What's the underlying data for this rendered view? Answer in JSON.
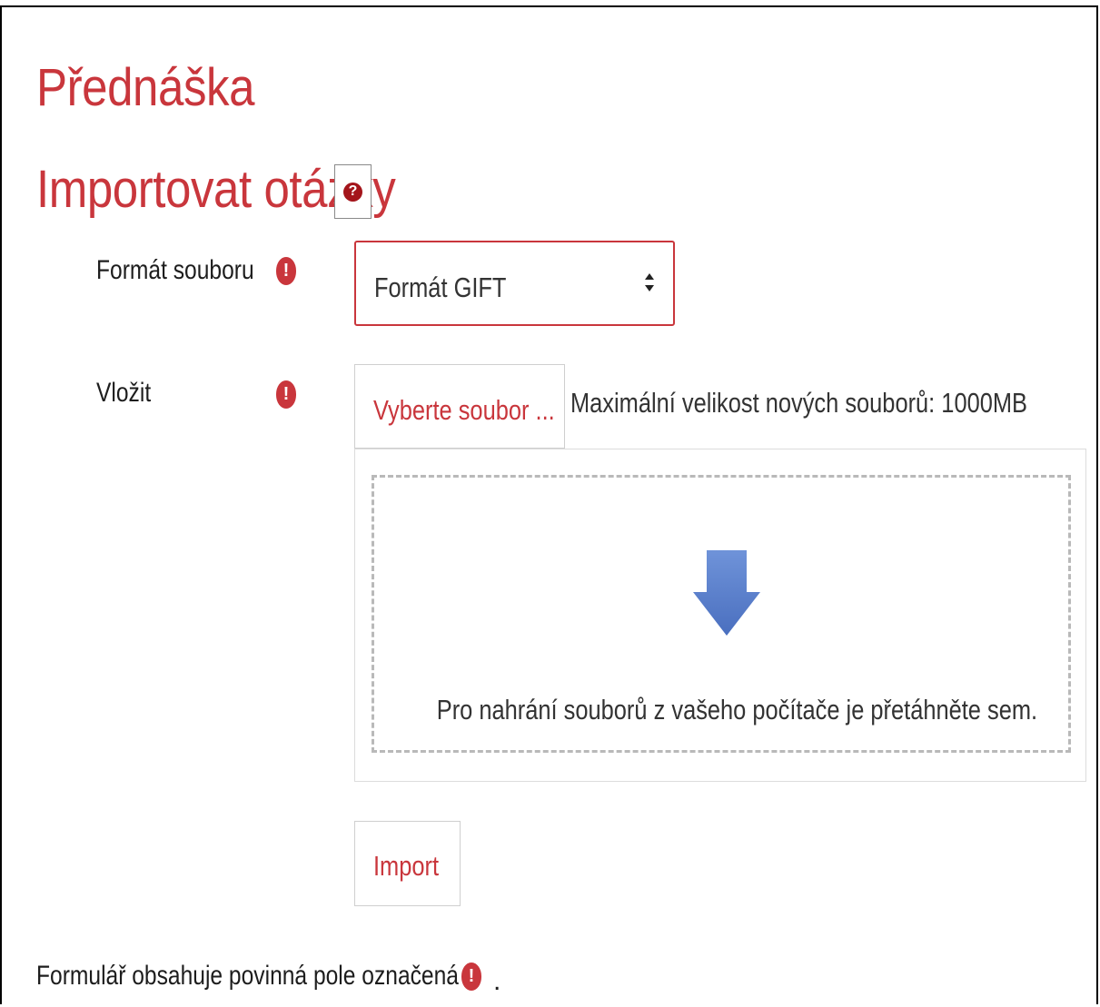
{
  "course": {
    "title": "Přednáška"
  },
  "page": {
    "title": "Importovat otázky",
    "help_icon": "question-circle-icon"
  },
  "form": {
    "format_label": "Formát souboru",
    "format_value": "Formát GIFT",
    "upload_label": "Vložit",
    "choose_file_label": "Vyberte soubor ...",
    "max_size_text": "Maximální velikost nových souborů: 1000MB",
    "dropzone_text": "Pro nahrání souborů z vašeho počítače je přetáhněte sem.",
    "import_label": "Import",
    "required_note": "Formulář obsahuje povinná pole označená",
    "required_note_end": "."
  },
  "colors": {
    "accent": "#c9363c",
    "help": "#a4151b",
    "arrow": "#5b7fc9"
  }
}
